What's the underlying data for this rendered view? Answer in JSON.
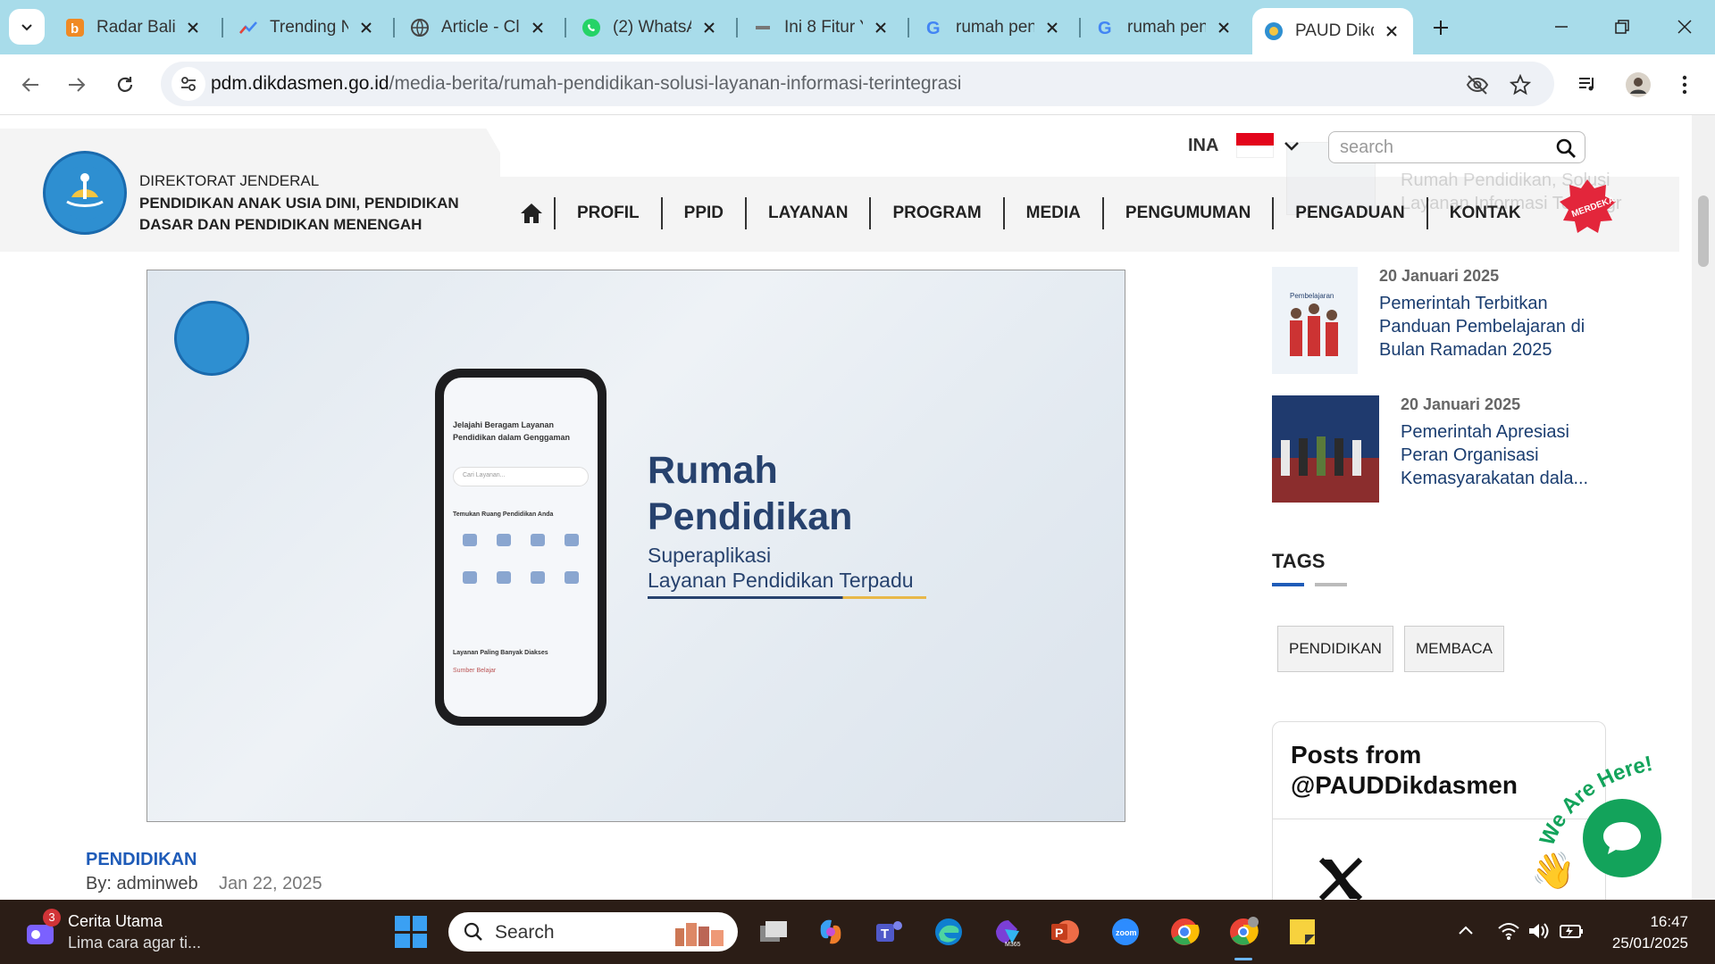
{
  "browser": {
    "tabs": [
      {
        "title": "Radar Bali",
        "icon": "radar-bali-icon",
        "active": false
      },
      {
        "title": "Trending N",
        "icon": "trending-icon",
        "active": false
      },
      {
        "title": "Article - Cl",
        "icon": "globe-icon",
        "active": false
      },
      {
        "title": "(2) WhatsA",
        "icon": "whatsapp-icon",
        "active": false
      },
      {
        "title": "Ini 8 Fitur Y",
        "icon": "news-site-icon",
        "active": false
      },
      {
        "title": "rumah pen",
        "icon": "google-icon",
        "active": false
      },
      {
        "title": "rumah pen",
        "icon": "google-icon",
        "active": false
      },
      {
        "title": "PAUD Dikd",
        "icon": "tutwuri-icon",
        "active": true
      }
    ],
    "url_host": "pdm.dikdasmen.go.id",
    "url_path": "/media-berita/rumah-pendidikan-solusi-layanan-informasi-terintegrasi"
  },
  "header": {
    "org_line1": "DIREKTORAT JENDERAL",
    "org_line2": "PENDIDIKAN ANAK USIA DINI, PENDIDIKAN",
    "org_line3": "DASAR DAN PENDIDIKAN MENENGAH",
    "lang": "INA",
    "search_placeholder": "search",
    "nav": [
      "PROFIL",
      "PPID",
      "LAYANAN",
      "PROGRAM",
      "MEDIA",
      "PENGUMUMAN",
      "PENGADUAN",
      "KONTAK"
    ],
    "ghost_title": "Rumah Pendidikan, Solusi Layanan Informasi Terintegr"
  },
  "hero": {
    "phone_heading": "Jelajahi Beragam Layanan Pendidikan dalam Genggaman",
    "phone_search": "Cari Layanan...",
    "phone_section": "Temukan Ruang Pendidikan Anda",
    "phone_section2": "Layanan Paling Banyak Diakses",
    "phone_item": "Sumber Belajar",
    "title_line1": "Rumah",
    "title_line2": "Pendidikan",
    "sub_line1": "Superaplikasi",
    "sub_line2": "Layanan Pendidikan Terpadu"
  },
  "article": {
    "category": "PENDIDIKAN",
    "author": "By: adminweb",
    "date": "Jan 22, 2025"
  },
  "sidebar": {
    "items": [
      {
        "date": "20 Januari 2025",
        "title": "Pemerintah Terbitkan Panduan Pembelajaran di Bulan Ramadan 2025"
      },
      {
        "date": "20 Januari 2025",
        "title": "Pemerintah Apresiasi Peran Organisasi Kemasyarakatan dala..."
      }
    ],
    "tags_heading": "TAGS",
    "tags": [
      "PENDIDIKAN",
      "MEMBACA"
    ],
    "posts_title_line1": "Posts from",
    "posts_title_line2": "@PAUDDikdasmen",
    "chat_label": "We Are Here!"
  },
  "taskbar": {
    "news_badge": "3",
    "news_title": "Cerita Utama",
    "news_sub": "Lima cara agar ti...",
    "search_label": "Search",
    "time": "16:47",
    "date": "25/01/2025"
  },
  "colors": {
    "tabstrip": "#a8dcea",
    "brand_blue": "#1e5bb8",
    "hero_navy": "#27426e",
    "chat_green": "#13a35b",
    "taskbar": "#2b1d16"
  }
}
